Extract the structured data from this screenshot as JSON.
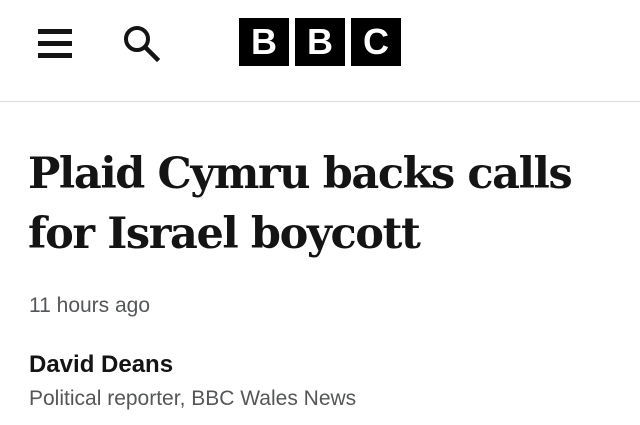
{
  "header": {
    "menu_icon": "hamburger-menu-icon",
    "search_icon": "search-icon",
    "logo_letters": [
      "B",
      "B",
      "C"
    ]
  },
  "article": {
    "headline": "Plaid Cymru backs calls for Israel boycott",
    "timestamp": "11 hours ago",
    "author": {
      "name": "David Deans",
      "role": "Political reporter, BBC Wales News"
    }
  },
  "colors": {
    "text_primary": "#141414",
    "text_secondary": "#545658",
    "logo_background": "#000000",
    "logo_text": "#ffffff",
    "divider": "#dcdcdc"
  }
}
